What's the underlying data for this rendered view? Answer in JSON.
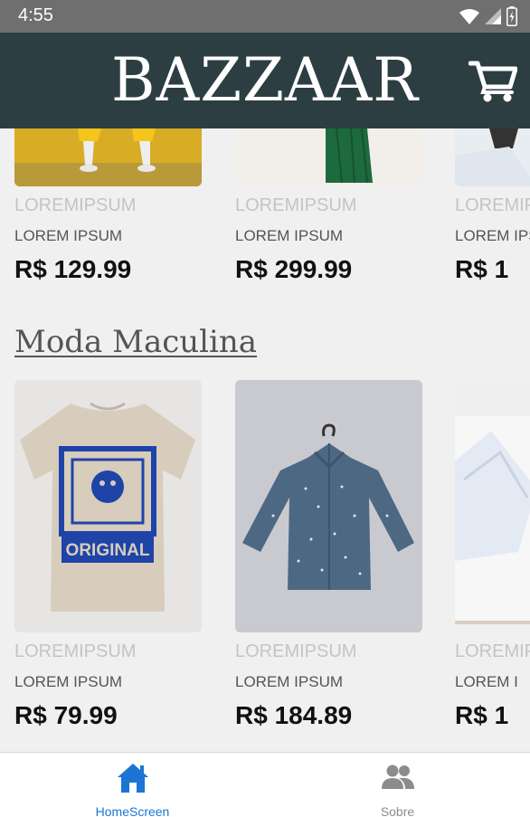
{
  "status_bar": {
    "time": "4:55"
  },
  "header": {
    "title": "BAZZAAR"
  },
  "top_row": {
    "cards": [
      {
        "brand": "LOREMIPSUM",
        "name": "LOREM IPSUM",
        "price": "R$ 129.99"
      },
      {
        "brand": "LOREMIPSUM",
        "name": "LOREM IPSUM",
        "price": "R$ 299.99"
      },
      {
        "brand": "LOREMIPSUM",
        "name": "LOREM IPSUM",
        "price": "R$ 1"
      }
    ]
  },
  "section": {
    "title": "Moda Maculina"
  },
  "masc_row": {
    "cards": [
      {
        "brand": "LOREMIPSUM",
        "name": "LOREM IPSUM",
        "price": "R$ 79.99",
        "shirt_print": "ORIGINAL"
      },
      {
        "brand": "LOREMIPSUM",
        "name": "LOREM IPSUM",
        "price": "R$ 184.89"
      },
      {
        "brand": "LOREMIPSUM",
        "name": "LOREM I",
        "price": "R$ 1"
      }
    ]
  },
  "tabs": [
    {
      "label": "HomeScreen",
      "icon": "home-icon",
      "active": true
    },
    {
      "label": "Sobre",
      "icon": "users-icon",
      "active": false
    }
  ],
  "colors": {
    "header": "#2c3e42",
    "active_tab": "#1e74d4",
    "inactive_tab": "#8c8c8c"
  }
}
